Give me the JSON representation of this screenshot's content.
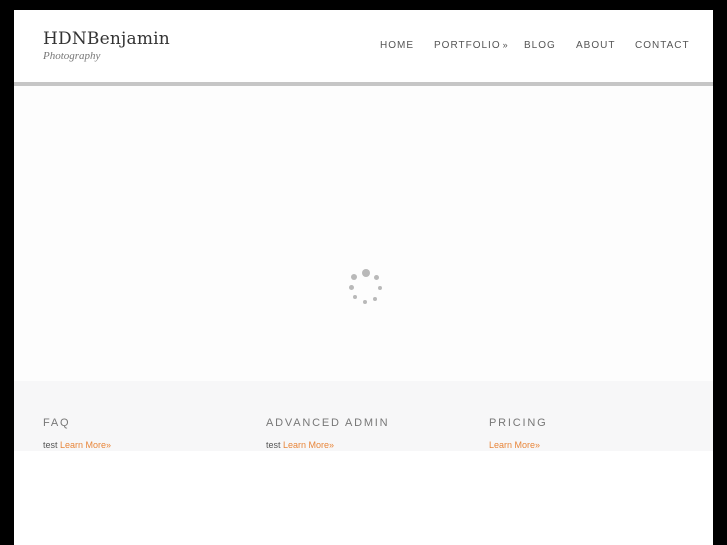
{
  "site": {
    "title": "HDNBenjamin",
    "subtitle": "Photography"
  },
  "nav": {
    "home": "HOME",
    "portfolio": "PORTFOLIO",
    "portfolio_chevron": "»",
    "blog": "BLOG",
    "about": "ABOUT",
    "contact": "CONTACT"
  },
  "slider": {
    "state": "loading",
    "spinner_icon": "loading-spinner-icon"
  },
  "widgets": [
    {
      "title": "FAQ",
      "text": "test",
      "link": "Learn More»"
    },
    {
      "title": "ADVANCED ADMIN",
      "text": "test",
      "link": "Learn More»"
    },
    {
      "title": "PRICING",
      "text": "",
      "link": "Learn More»"
    }
  ],
  "colors": {
    "outer_background": "#000000",
    "page_background": "#ffffff",
    "header_rule": "#c6c6c6",
    "footer_background": "#f7f7f8",
    "link_accent": "#e8863a",
    "spinner": "#b9b9b9"
  }
}
